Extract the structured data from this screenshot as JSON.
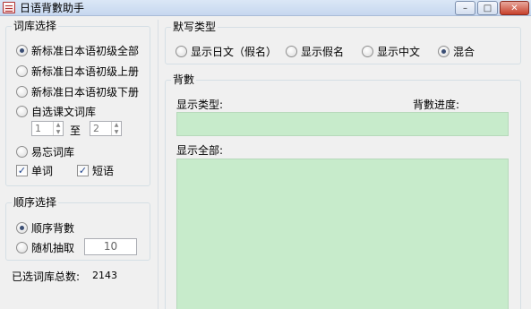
{
  "window": {
    "title": "日语背數助手",
    "min": "–",
    "max": "□",
    "close": "✕"
  },
  "lexicon": {
    "title": "词库选择",
    "options": [
      {
        "label": "新标准日本语初级全部",
        "selected": true
      },
      {
        "label": "新标准日本语初级上册",
        "selected": false
      },
      {
        "label": "新标准日本语初级下册",
        "selected": false
      },
      {
        "label": "自选课文词库",
        "selected": false
      }
    ],
    "range_from": "1",
    "range_to_label": "至",
    "range_to": "2",
    "forget_label": "易忘词库",
    "word_label": "单词",
    "word_checked": true,
    "phrase_label": "短语",
    "phrase_checked": true
  },
  "order": {
    "title": "顺序选择",
    "sequential_label": "顺序背數",
    "random_label": "随机抽取",
    "random_count": "10"
  },
  "total": {
    "label": "已选词库总数:",
    "value": "2143"
  },
  "dictation": {
    "title": "默写类型",
    "options": [
      {
        "label": "显示日文（假名）",
        "selected": false
      },
      {
        "label": "显示假名",
        "selected": false
      },
      {
        "label": "显示中文",
        "selected": false
      },
      {
        "label": "混合",
        "selected": true
      }
    ]
  },
  "recite": {
    "title": "背數",
    "type_label": "显示类型:",
    "progress_label": "背數进度:",
    "all_label": "显示全部:"
  },
  "colors": {
    "panel_green": "#c7ebcb",
    "radio_dot": "#3b4e74"
  }
}
